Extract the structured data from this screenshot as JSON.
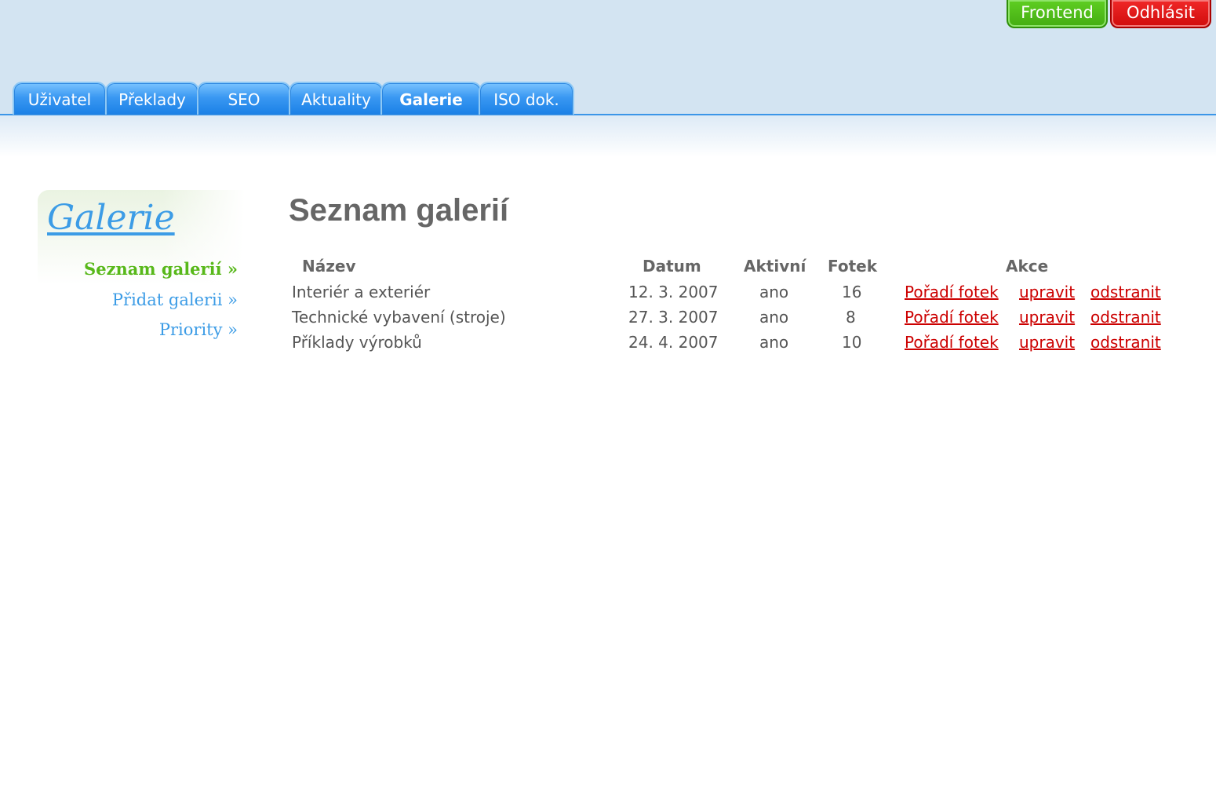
{
  "top_buttons": {
    "frontend": "Frontend",
    "logout": "Odhlásit"
  },
  "tabs": [
    {
      "label": "Uživatel",
      "active": false
    },
    {
      "label": "Překlady",
      "active": false
    },
    {
      "label": "SEO",
      "active": false
    },
    {
      "label": "Aktuality",
      "active": false
    },
    {
      "label": "Galerie",
      "active": true
    },
    {
      "label": "ISO dok.",
      "active": false
    }
  ],
  "sidebar": {
    "title": "Galerie",
    "links": [
      {
        "label": "Seznam galerií »",
        "active": true
      },
      {
        "label": "Přidat galerii »",
        "active": false
      },
      {
        "label": "Priority »",
        "active": false
      }
    ]
  },
  "main": {
    "title": "Seznam galerií",
    "columns": {
      "name": "Název",
      "date": "Datum",
      "active": "Aktivní",
      "photos": "Fotek",
      "actions": "Akce"
    },
    "rows": [
      {
        "name": "Interiér a exteriér",
        "date": "12. 3. 2007",
        "active": "ano",
        "photos": "16",
        "order": "Pořadí fotek",
        "edit": "upravit",
        "delete": "odstranit"
      },
      {
        "name": "Technické vybavení (stroje)",
        "date": "27. 3. 2007",
        "active": "ano",
        "photos": "8",
        "order": "Pořadí fotek",
        "edit": "upravit",
        "delete": "odstranit"
      },
      {
        "name": "Příklady výrobků",
        "date": "24. 4. 2007",
        "active": "ano",
        "photos": "10",
        "order": "Pořadí fotek",
        "edit": "upravit",
        "delete": "odstranit"
      }
    ]
  },
  "colors": {
    "tab_blue": "#1a80e6",
    "frontend_green": "#44ad12",
    "logout_red": "#d00c0c",
    "link_red": "#cc0000",
    "sidebar_blue": "#3c9ce6",
    "sidebar_active_green": "#58b81a"
  }
}
